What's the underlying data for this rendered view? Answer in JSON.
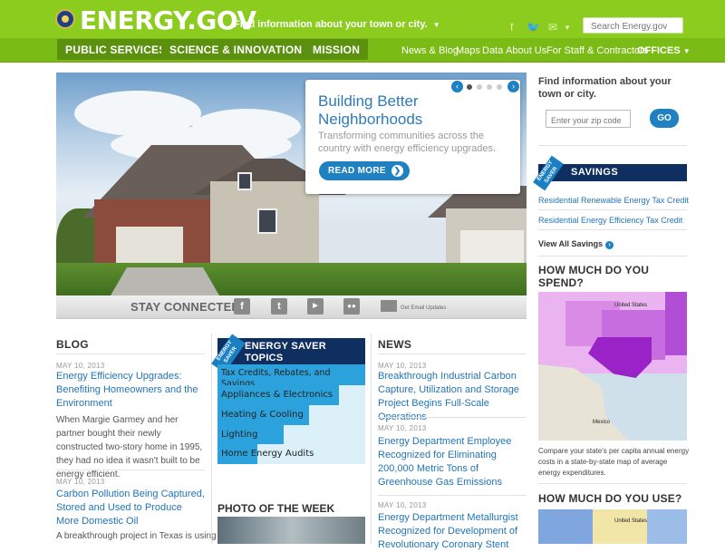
{
  "header": {
    "logo_text": "ENERGY.GOV",
    "town_link": "Find information about your town or city.",
    "search_placeholder": "Search Energy.gov"
  },
  "primary_nav": [
    "PUBLIC SERVICES",
    "SCIENCE & INNOVATION",
    "MISSION"
  ],
  "secondary_nav": [
    "News & Blog",
    "Maps",
    "Data",
    "About Us",
    "For Staff & Contractors",
    "OFFICES"
  ],
  "hero": {
    "title": "Building Better Neighborhoods",
    "text": "Transforming communities across the country with energy efficiency upgrades.",
    "button": "READ MORE"
  },
  "stay_connected": {
    "label": "STAY CONNECTED",
    "email_label": "Get Email Updates"
  },
  "blog": {
    "heading": "BLOG",
    "posts": [
      {
        "date": "MAY 10, 2013",
        "title": "Energy Efficiency Upgrades: Benefiting Homeowners and the Environment",
        "excerpt": "When Margie Garmey and her partner bought their newly constructed two-story home in 1995, they had no idea it wasn't built to be energy efficient."
      },
      {
        "date": "MAY 10, 2013",
        "title": "Carbon Pollution Being Captured, Stored and Used to Produce More Domestic Oil",
        "excerpt": "A breakthrough project in Texas is using"
      }
    ]
  },
  "energy_saver": {
    "ribbon": "ENERGY SAVER",
    "title": "ENERGY SAVER TOPICS",
    "topics": [
      {
        "label": "Tax Credits, Rebates, and Savings",
        "level": 1.0
      },
      {
        "label": "Appliances & Electronics",
        "level": 0.82
      },
      {
        "label": "Heating & Cooling",
        "level": 0.62
      },
      {
        "label": "Lighting",
        "level": 0.45
      },
      {
        "label": "Home Energy Audits",
        "level": 0.27
      }
    ],
    "photo_heading": "PHOTO OF THE WEEK"
  },
  "news": {
    "heading": "NEWS",
    "posts": [
      {
        "date": "MAY 10, 2013",
        "title": "Breakthrough Industrial Carbon Capture, Utilization and Storage Project Begins Full-Scale Operations"
      },
      {
        "date": "MAY 10, 2013",
        "title": "Energy Department Employee Recognized for Eliminating 200,000 Metric Tons of Greenhouse Gas Emissions"
      },
      {
        "date": "MAY 10, 2013",
        "title": "Energy Department Metallurgist Recognized for Development of Revolutionary Coronary Stent"
      }
    ]
  },
  "sidebar": {
    "title": "Find information about your town or city.",
    "zip_placeholder": "Enter your zip code",
    "go": "GO",
    "savings_ribbon": "ENERGY SAVER",
    "savings_title": "SAVINGS",
    "savings_links": [
      "Residential Renewable Energy Tax Credit",
      "Residential Energy Efficiency Tax Credit"
    ],
    "view_all": "View All Savings",
    "spend_heading": "HOW MUCH DO YOU SPEND?",
    "map_labels": [
      "United States",
      "Mexico"
    ],
    "map_caption": "Compare your state's per capita annual energy costs in a state-by-state map of average energy expenditures.",
    "use_heading": "HOW MUCH DO YOU USE?",
    "map2_label": "United States"
  },
  "colors": {
    "header_green": "#8ccc1e",
    "nav_green": "#7bbb15",
    "link_blue": "#2275b5",
    "navy": "#0f2f60",
    "accent_blue": "#1f81c1"
  }
}
